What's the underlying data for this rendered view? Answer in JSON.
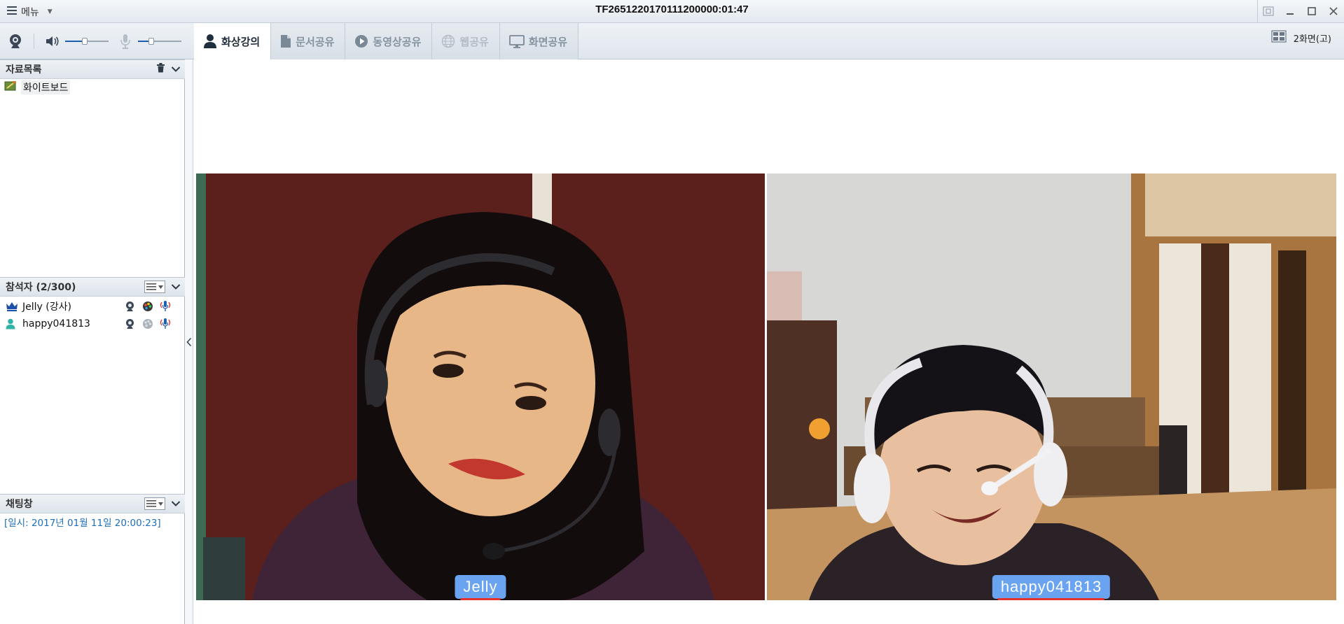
{
  "titlebar": {
    "menu_label": "메뉴",
    "session_title": "TF2651220170111200000:01:47"
  },
  "toolbar": {
    "tabs": [
      {
        "label": "화상강의",
        "icon": "person-icon",
        "state": "active"
      },
      {
        "label": "문서공유",
        "icon": "document-icon",
        "state": "normal"
      },
      {
        "label": "동영상공유",
        "icon": "play-icon",
        "state": "normal"
      },
      {
        "label": "웹공유",
        "icon": "globe-icon",
        "state": "disabled"
      },
      {
        "label": "화면공유",
        "icon": "monitor-icon",
        "state": "normal"
      }
    ],
    "speaker_volume": 0.45,
    "mic_volume": 0.3,
    "layout_label": "2화면(고)"
  },
  "sidebar": {
    "files": {
      "title": "자료목록",
      "items": [
        {
          "label": "화이트보드",
          "icon": "whiteboard-icon"
        }
      ]
    },
    "participants": {
      "title": "참석자 (2/300)",
      "items": [
        {
          "name": "Jelly (강사)",
          "role_icon": "crown-icon"
        },
        {
          "name": "happy041813",
          "role_icon": "user-icon"
        }
      ]
    },
    "chat": {
      "title": "채팅창",
      "lines": [
        "[일시: 2017년 01월 11일 20:00:23]"
      ]
    }
  },
  "videos": [
    {
      "label": "Jelly"
    },
    {
      "label": "happy041813"
    }
  ],
  "colors": {
    "accent_blue": "#1d5fb0",
    "name_tag_bg": "#6aa4f0",
    "name_tag_bar": "#e8332c",
    "chat_text": "#1e6fb8"
  }
}
